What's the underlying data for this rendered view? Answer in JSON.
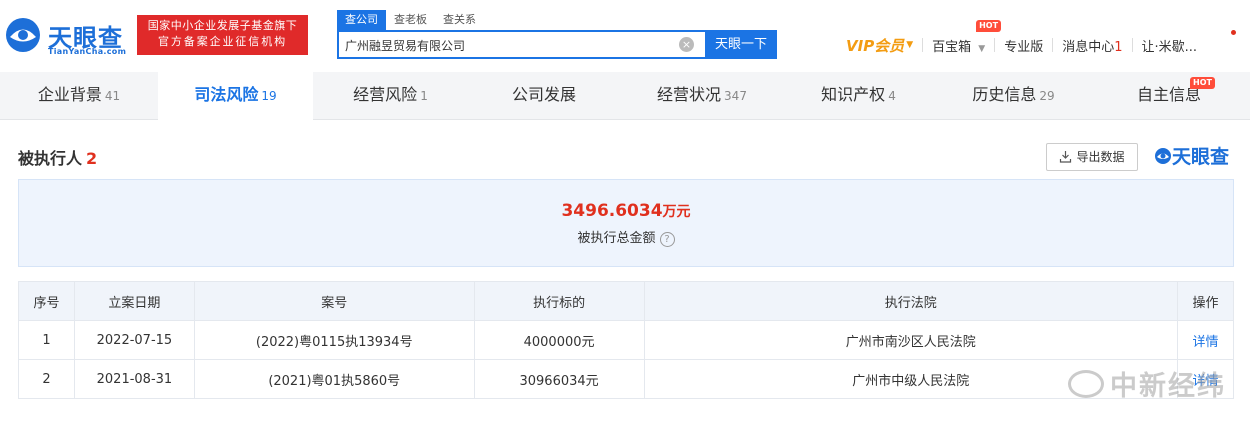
{
  "header": {
    "logo_text": "天眼查",
    "logo_sub": "TianYanCha.com",
    "badge_line1": "国家中小企业发展子基金旗下",
    "badge_line2": "官方备案企业征信机构",
    "search_tabs": [
      "查公司",
      "查老板",
      "查关系"
    ],
    "search_value": "广州融昱贸易有限公司",
    "search_button": "天眼一下",
    "nav": {
      "vip": "VIP会员",
      "treasure": "百宝箱",
      "pro": "专业版",
      "messages": "消息中心",
      "message_count": "1",
      "user": "让·米歇...",
      "hot": "HOT"
    }
  },
  "tabs": [
    {
      "label": "企业背景",
      "count": "41"
    },
    {
      "label": "司法风险",
      "count": "19"
    },
    {
      "label": "经营风险",
      "count": "1"
    },
    {
      "label": "公司发展",
      "count": ""
    },
    {
      "label": "经营状况",
      "count": "347"
    },
    {
      "label": "知识产权",
      "count": "4"
    },
    {
      "label": "历史信息",
      "count": "29"
    },
    {
      "label": "自主信息",
      "count": ""
    }
  ],
  "section": {
    "title": "被执行人",
    "count": "2",
    "export_label": "导出数据",
    "brand": "天眼查",
    "summary_amount": "3496.6034",
    "summary_unit": "万元",
    "summary_label": "被执行总金额",
    "help_icon": "?"
  },
  "table": {
    "headers": [
      "序号",
      "立案日期",
      "案号",
      "执行标的",
      "执行法院",
      "操作"
    ],
    "rows": [
      [
        "1",
        "2022-07-15",
        "(2022)粤0115执13934号",
        "4000000元",
        "广州市南沙区人民法院",
        "详情"
      ],
      [
        "2",
        "2021-08-31",
        "(2021)粤01执5860号",
        "30966034元",
        "广州市中级人民法院",
        "详情"
      ]
    ]
  },
  "watermark": "中新经纬",
  "colors": {
    "brand_blue": "#1b74e4",
    "alert_red": "#e0301e",
    "vip_orange": "#f39c12"
  }
}
